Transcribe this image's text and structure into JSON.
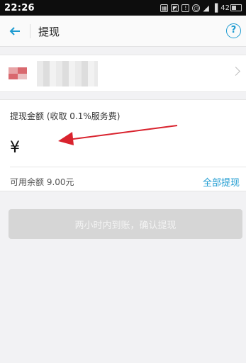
{
  "status_bar": {
    "time": "22:26",
    "battery": "42"
  },
  "navbar": {
    "title": "提现"
  },
  "amount": {
    "label": "提现金额 (收取 0.1%服务费)",
    "currency_symbol": "¥",
    "input_value": "",
    "available_text": "可用余额 9.00元",
    "withdraw_all_label": "全部提现"
  },
  "confirm_button_label": "两小时内到账，确认提现",
  "colors": {
    "accent": "#1d9bd1",
    "arrow": "#d9232e",
    "disabled_button": "#d6d6d6"
  },
  "icons": {
    "back": "arrow-left-icon",
    "help": "help-icon",
    "chevron": "chevron-right-icon"
  }
}
